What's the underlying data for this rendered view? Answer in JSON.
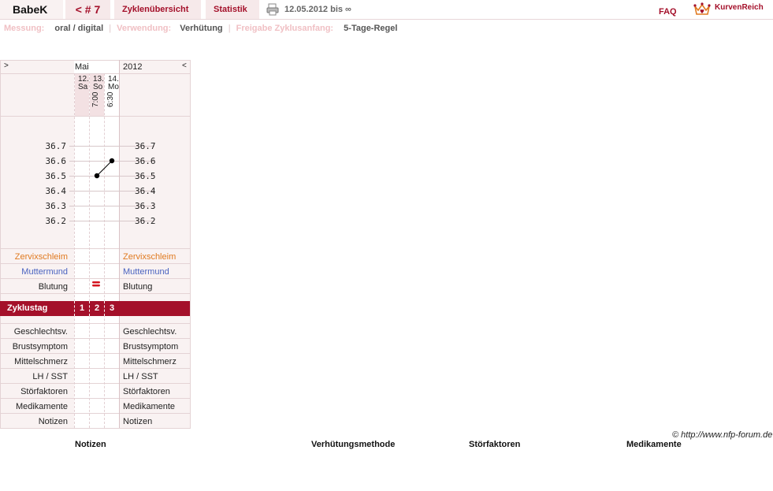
{
  "topbar": {
    "user": "BabeK",
    "cycle": "< # 7",
    "tabs": [
      "Zyklenübersicht",
      "Statistik"
    ],
    "date_range": "12.05.2012 bis ∞",
    "faq": "FAQ",
    "brand": "KurvenReich",
    "printer_icon": "printer-icon",
    "logo_icon": "crown-heart-icon"
  },
  "info": {
    "measure_label": "Messung:",
    "measure_value": "oral / digital",
    "use_label": "Verwendung:",
    "use_value": "Verhütung",
    "release_label": "Freigabe Zyklusanfang:",
    "release_value": "5-Tage-Regel"
  },
  "chart": {
    "nav_prev": ">",
    "nav_next": "<",
    "month": "Mai",
    "year": "2012",
    "days": [
      {
        "day": "12.",
        "weekday": "Sa",
        "time": ""
      },
      {
        "day": "13.",
        "weekday": "So",
        "time": "7:00"
      },
      {
        "day": "14.",
        "weekday": "Mo",
        "time": "6:30"
      }
    ],
    "temp_ticks": [
      "36.7",
      "36.6",
      "36.5",
      "36.4",
      "36.3",
      "36.2"
    ],
    "rows_colored": [
      "Zervixschleim",
      "Muttermund"
    ],
    "row_blutung": "Blutung",
    "zyklustag_label": "Zyklustag",
    "zyklustag_values": [
      "1",
      "2",
      "3"
    ],
    "rows_bottom": [
      "Geschlechtsv.",
      "Brustsymptom",
      "Mittelschmerz",
      "LH / SST",
      "Störfaktoren",
      "Medikamente",
      "Notizen"
    ]
  },
  "chart_data": {
    "type": "line",
    "x": [
      "13.",
      "14."
    ],
    "series": [
      {
        "values": [
          36.5,
          36.6
        ]
      }
    ],
    "ylim": [
      36.2,
      36.7
    ]
  },
  "colors": {
    "accent": "#a4102a",
    "panel": "#f9f2f2",
    "orange": "#e07a20",
    "blue": "#4a63c0"
  },
  "footer": {
    "link": "© http://www.nfp-forum.de",
    "headings": [
      "Notizen",
      "Verhütungsmethode",
      "Störfaktoren",
      "Medikamente"
    ]
  }
}
